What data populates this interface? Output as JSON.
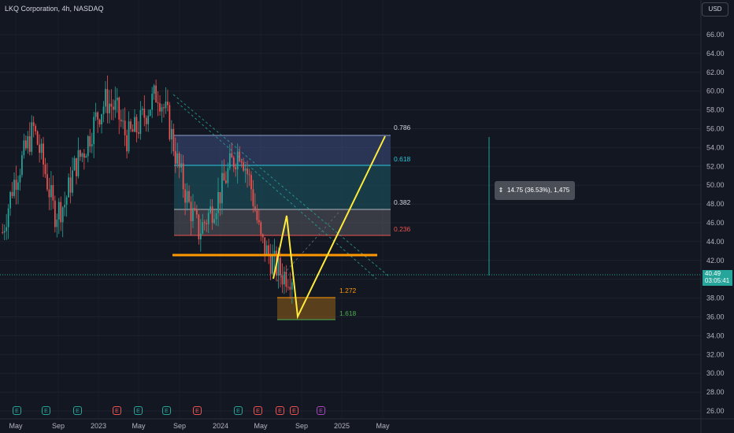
{
  "header": {
    "title": "LKQ Corporation, 4h, NASDAQ"
  },
  "toolbar": {
    "currency": "USD"
  },
  "price_axis": {
    "ticks": [
      "66.00",
      "64.00",
      "62.00",
      "60.00",
      "58.00",
      "56.00",
      "54.00",
      "52.00",
      "50.00",
      "48.00",
      "46.00",
      "44.00",
      "42.00",
      "40.00",
      "38.00",
      "36.00",
      "34.00",
      "32.00",
      "30.00",
      "28.00",
      "26.00"
    ],
    "current_price": "40.49",
    "countdown": "03:05:41"
  },
  "time_axis": {
    "labels": [
      "May",
      "Sep",
      "2023",
      "May",
      "Sep",
      "2024",
      "May",
      "Sep",
      "2025",
      "May"
    ]
  },
  "fib": {
    "levels": [
      "0.786",
      "0.618",
      "0.382",
      "0.236"
    ],
    "extension_levels": [
      "1.272",
      "1.618"
    ]
  },
  "measure": {
    "text": "14.75 (36.53%), 1,475"
  },
  "events": [
    "E",
    "E",
    "E",
    "E",
    "E",
    "E",
    "E",
    "E",
    "E",
    "E",
    "E",
    "E"
  ],
  "colors": {
    "background": "#131722",
    "up": "#26a69a",
    "down": "#ef5350",
    "fib_0786": "#5b6b9b",
    "fib_0618": "#26c6da",
    "fib_0382": "#b2b5be",
    "fib_0236": "#ef5350",
    "fib_1272": "#ff9800",
    "fib_1618": "#4caf50",
    "drawing_yellow": "#ffeb3b",
    "support_orange": "#ff9800"
  },
  "chart_data": {
    "type": "candlestick",
    "symbol": "LKQ",
    "interval": "4h",
    "exchange": "NASDAQ",
    "ylim": [
      26,
      66
    ],
    "x_labels": [
      "May",
      "Sep",
      "2023",
      "May",
      "Sep",
      "2024",
      "May",
      "Sep",
      "2025",
      "May"
    ],
    "price_path": {
      "x": [
        "2022-04",
        "2022-05",
        "2022-06",
        "2022-07",
        "2022-08",
        "2022-09",
        "2022-10",
        "2022-11",
        "2022-12",
        "2023-01",
        "2023-02",
        "2023-03",
        "2023-04",
        "2023-05",
        "2023-06",
        "2023-07",
        "2023-08",
        "2023-09",
        "2023-10",
        "2023-11",
        "2023-12",
        "2024-01",
        "2024-02",
        "2024-03",
        "2024-04",
        "2024-05",
        "2024-06",
        "2024-07",
        "2024-08"
      ],
      "y": [
        45,
        50,
        53,
        56,
        52,
        47,
        48,
        52,
        54,
        57,
        59,
        58,
        55,
        56,
        58,
        60,
        57,
        52,
        48,
        45,
        47,
        49,
        52,
        54,
        50,
        44,
        42,
        40.5,
        40.49
      ]
    },
    "fib_retracement": [
      {
        "level": "0.786",
        "price": 55.3
      },
      {
        "level": "0.618",
        "price": 52.1
      },
      {
        "level": "0.382",
        "price": 47.5
      },
      {
        "level": "0.236",
        "price": 44.6
      }
    ],
    "fib_extension": [
      {
        "level": "1.272",
        "price": 37.9
      },
      {
        "level": "1.618",
        "price": 35.6
      }
    ],
    "support_price": 42.6,
    "current_price": 40.49,
    "measure": {
      "change": 14.75,
      "percent": 36.53,
      "bars": 1475
    },
    "projection_path": [
      {
        "date": "2024-07",
        "price": 40.0
      },
      {
        "date": "2024-07",
        "price": 46.8
      },
      {
        "date": "2024-08",
        "price": 36.0
      },
      {
        "date": "2025-03",
        "price": 55.2
      }
    ]
  }
}
